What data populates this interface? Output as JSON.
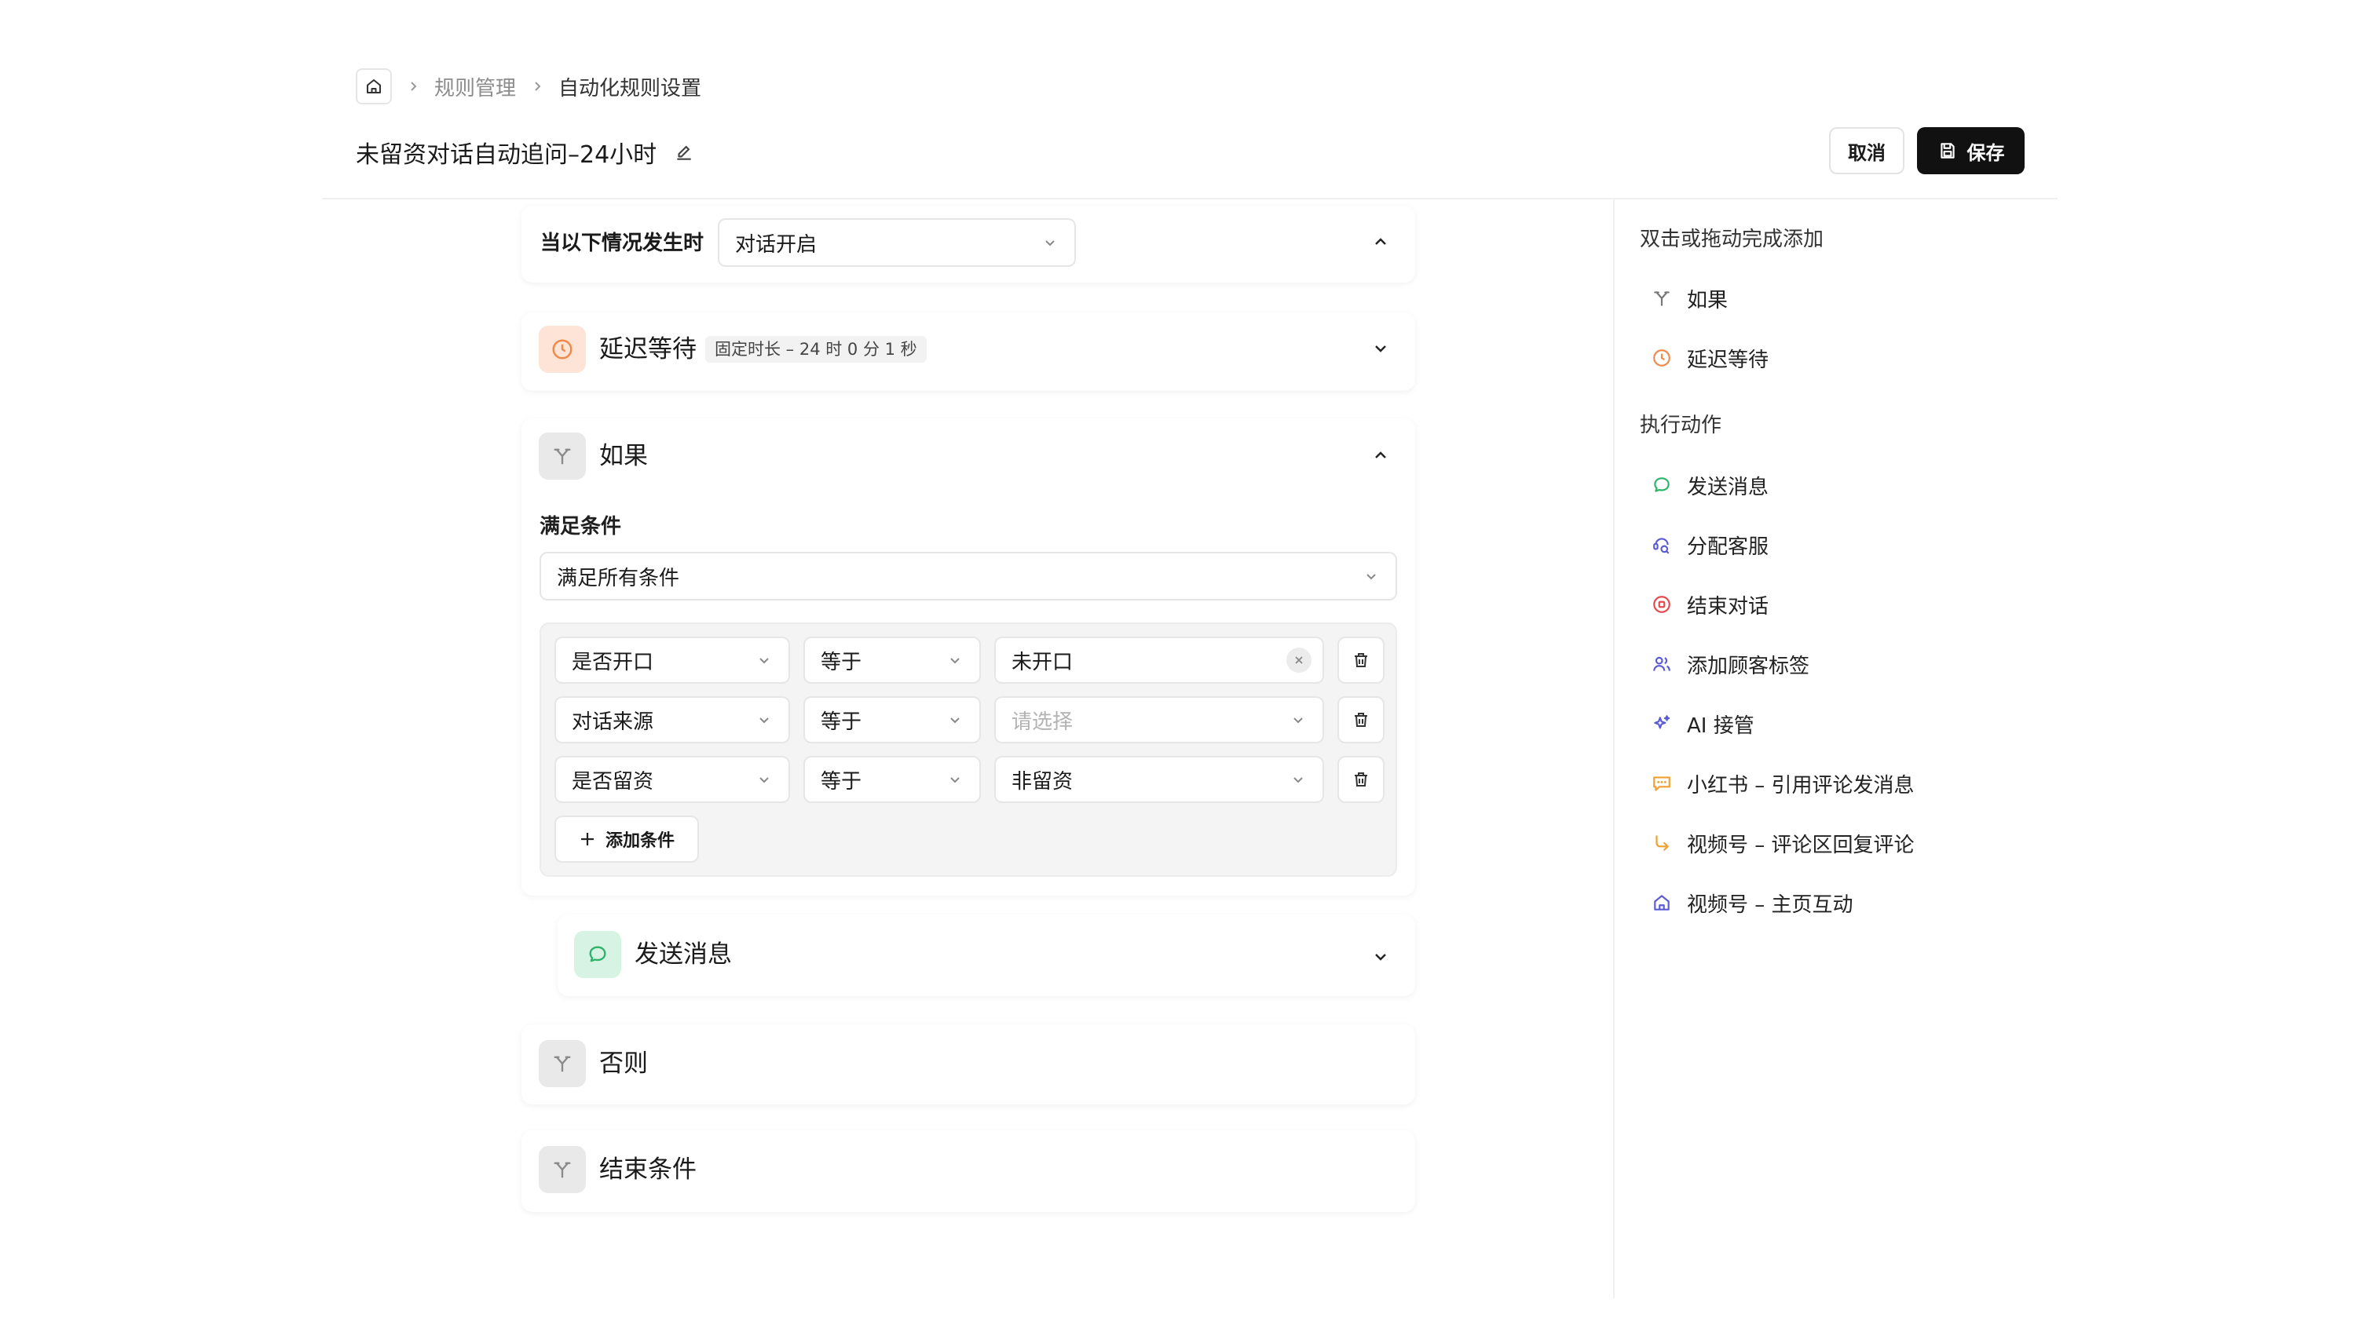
{
  "breadcrumb": {
    "items": [
      "规则管理",
      "自动化规则设置"
    ]
  },
  "page": {
    "title": "未留资对话自动追问–24小时"
  },
  "actions": {
    "cancel_label": "取消",
    "save_label": "保存"
  },
  "trigger": {
    "label": "当以下情况发生时",
    "value": "对话开启"
  },
  "delay": {
    "title": "延迟等待",
    "badge": "固定时长 – 24 时 0 分 1 秒"
  },
  "if_block": {
    "title": "如果",
    "conditions_label": "满足条件",
    "match_mode": "满足所有条件",
    "conditions": [
      {
        "field": "是否开口",
        "operator": "等于",
        "value": "未开口",
        "placeholder": ""
      },
      {
        "field": "对话来源",
        "operator": "等于",
        "value": "",
        "placeholder": "请选择"
      },
      {
        "field": "是否留资",
        "operator": "等于",
        "value": "非留资",
        "placeholder": ""
      }
    ],
    "add_condition_label": "添加条件",
    "action_title": "发送消息"
  },
  "else_block": {
    "title": "否则"
  },
  "end_block": {
    "title": "结束条件"
  },
  "right_panel": {
    "hint": "双击或拖动完成添加",
    "controls": [
      {
        "label": "如果",
        "icon": "branch-icon"
      },
      {
        "label": "延迟等待",
        "icon": "clock-icon"
      }
    ],
    "actions_heading": "执行动作",
    "actions": [
      {
        "label": "发送消息",
        "icon": "chat-bubble-icon",
        "color": "#2fb26a"
      },
      {
        "label": "分配客服",
        "icon": "assign-agent-icon",
        "color": "#5b5bd6"
      },
      {
        "label": "结束对话",
        "icon": "stop-circle-icon",
        "color": "#e5484d"
      },
      {
        "label": "添加顾客标签",
        "icon": "users-icon",
        "color": "#5b5bd6"
      },
      {
        "label": "AI 接管",
        "icon": "sparkle-icon",
        "color": "#5b5bd6"
      },
      {
        "label": "小红书 – 引用评论发消息",
        "icon": "comment-quote-icon",
        "color": "#f0a030"
      },
      {
        "label": "视频号 – 评论区回复评论",
        "icon": "reply-arrow-icon",
        "color": "#f0a030"
      },
      {
        "label": "视频号 – 主页互动",
        "icon": "home-icon",
        "color": "#5b5bd6"
      }
    ]
  },
  "colors": {
    "primary_button": "#111111",
    "delay_accent": "#f08a4b",
    "message_accent": "#2fb26a"
  }
}
